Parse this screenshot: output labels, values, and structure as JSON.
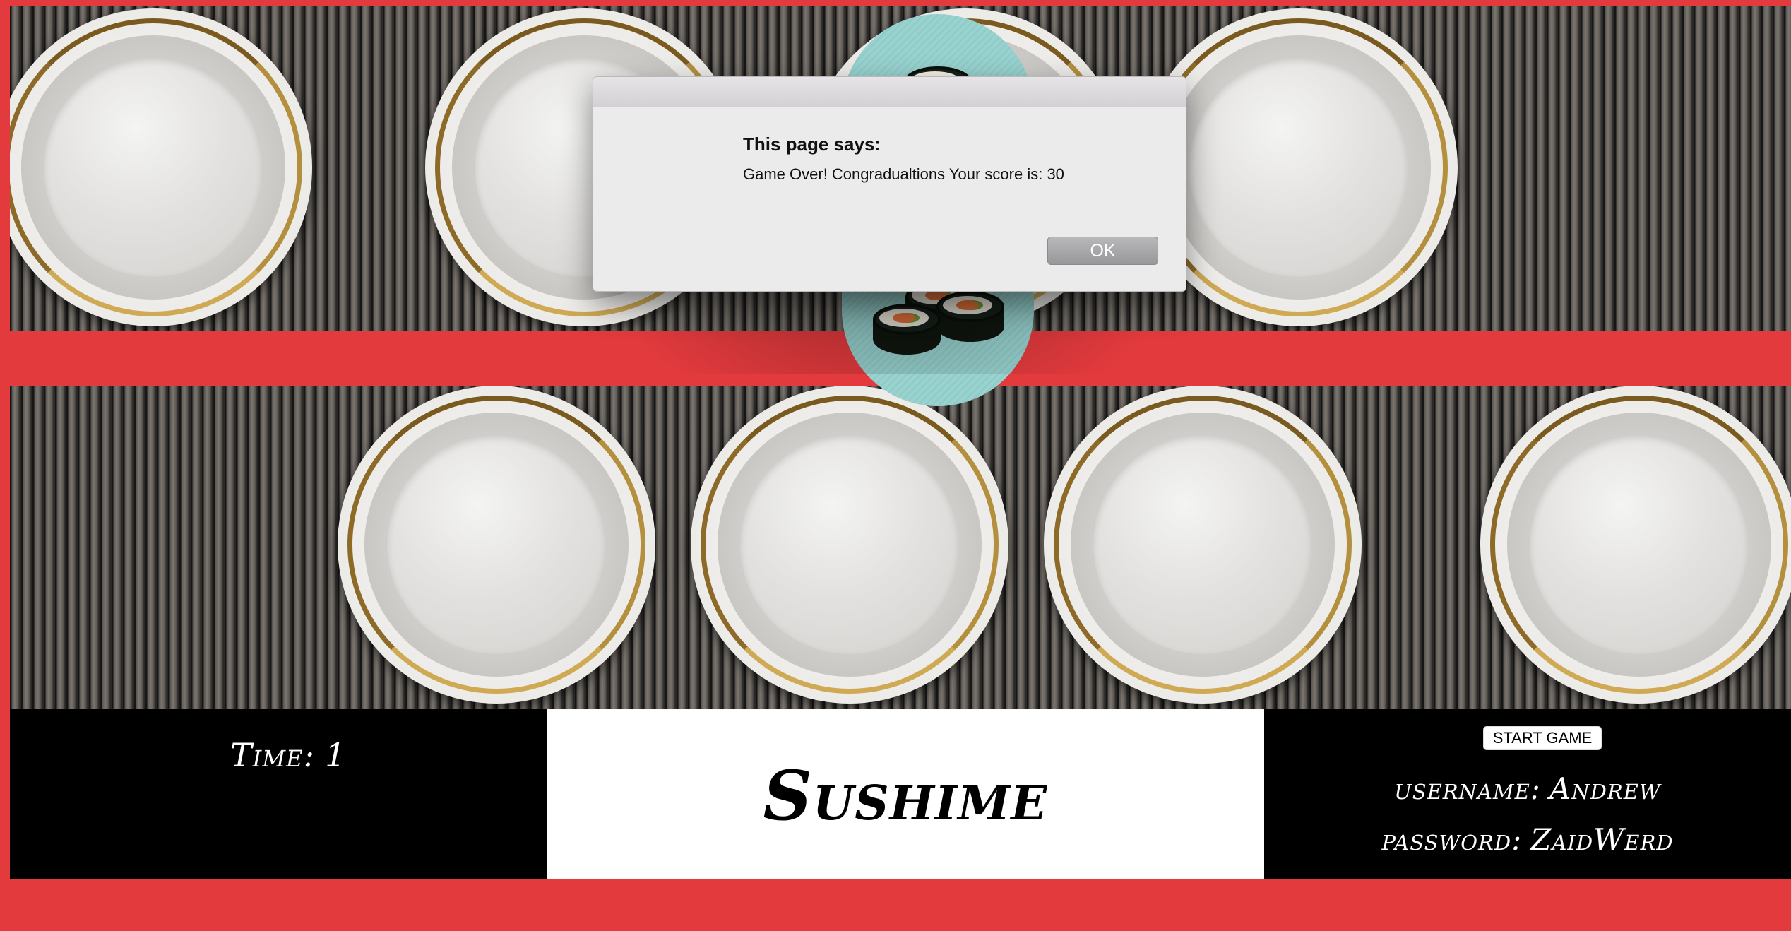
{
  "dialog": {
    "heading": "This page says:",
    "message": "Game Over! Congradualtions Your score is: 30",
    "ok_label": "OK"
  },
  "hud": {
    "time_label": "Time:",
    "time_value": "1",
    "title": "Sushime",
    "start_button": "START GAME",
    "username_label": "username:",
    "username_value": "Andrew",
    "password_label": "password:",
    "password_value": "ZaidWerd"
  },
  "colors": {
    "background_red": "#e23a3d",
    "sushi_plate_teal": "#99d2cf",
    "plate_gold": "#b48f3e"
  }
}
